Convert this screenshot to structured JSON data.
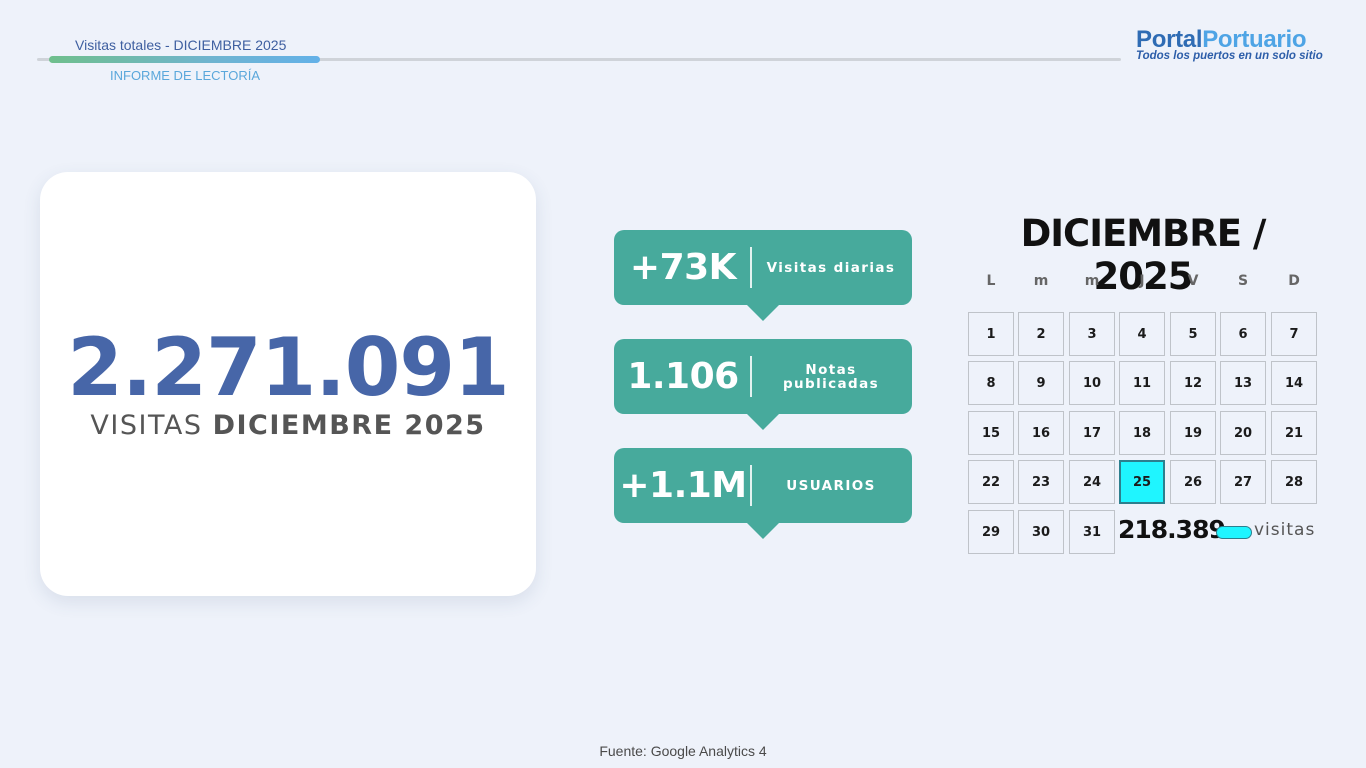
{
  "header": {
    "title": "Visitas totales - DICIEMBRE 2025",
    "subtitle": "INFORME DE LECTORÍA",
    "progress": 0.25
  },
  "logo": {
    "part1": "Portal",
    "part2": "Portuario",
    "tagline": "Todos los puertos en un solo sitio"
  },
  "summary": {
    "total_visits": "2.271.091",
    "caption_prefix": "VISITAS",
    "caption_bold": "DICIEMBRE 2025"
  },
  "stats": [
    {
      "value": "+73K",
      "label": "Visitas diarias"
    },
    {
      "value": "1.106",
      "label": "Notas publicadas"
    },
    {
      "value": "+1.1M",
      "label": "USUARIOS"
    }
  ],
  "calendar": {
    "title": "DICIEMBRE / 2025",
    "weekdays": [
      "L",
      "m",
      "m",
      "J",
      "V",
      "S",
      "D"
    ],
    "days": [
      "1",
      "2",
      "3",
      "4",
      "5",
      "6",
      "7",
      "8",
      "9",
      "10",
      "11",
      "12",
      "13",
      "14",
      "15",
      "16",
      "17",
      "18",
      "19",
      "20",
      "21",
      "22",
      "23",
      "24",
      "25",
      "26",
      "27",
      "28",
      "29",
      "30",
      "31"
    ],
    "highlight_day": "25",
    "highlight_visits": "218.389",
    "visits_label": "visitas"
  },
  "footer": "Fuente: Google Analytics 4",
  "colors": {
    "accent_blue": "#4766a8",
    "stat_green": "#47aa9c",
    "highlight_cyan": "#1ff5ff"
  }
}
